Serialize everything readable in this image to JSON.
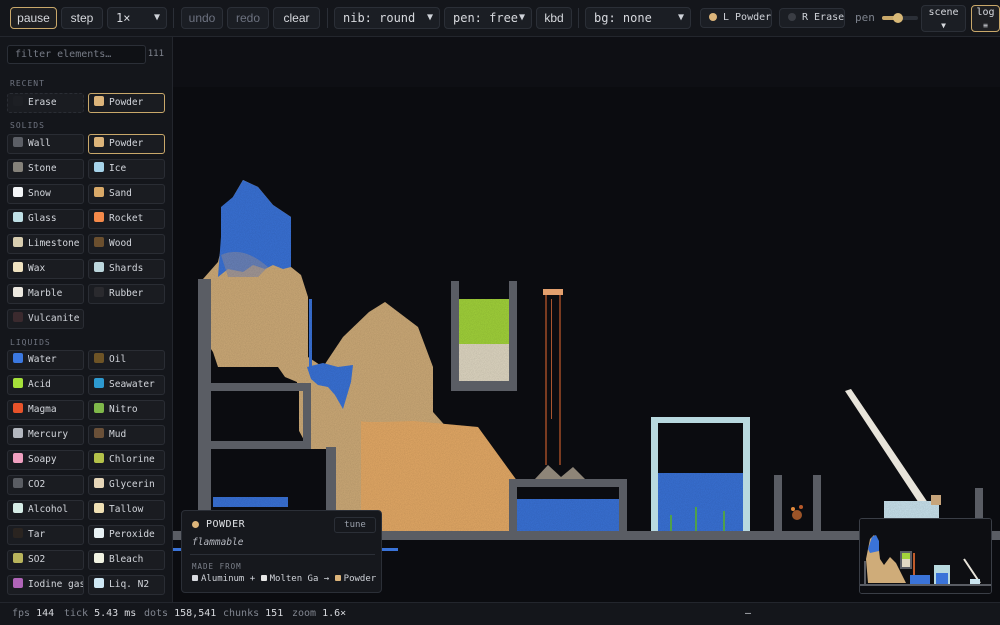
{
  "toolbar": {
    "pause": "pause",
    "step": "step",
    "speed": "1×",
    "undo": "undo",
    "redo": "redo",
    "clear": "clear",
    "nib": "nib: round",
    "pen": "pen: free",
    "kbd": "kbd",
    "bg": "bg: none",
    "left_brush": "L Powder",
    "right_brush": "R Erase",
    "pen_label": "pen",
    "pen_level": 0.45,
    "scene": "scene",
    "log": "log"
  },
  "sidebar": {
    "filter_placeholder": "filter elements…",
    "count": "111",
    "recent_label": "RECENT",
    "recent": [
      {
        "label": "Erase",
        "color": "#1d1f24"
      },
      {
        "label": "Powder",
        "color": "#dcb47a"
      }
    ],
    "solids_label": "SOLIDS",
    "solids": [
      {
        "label": "Wall",
        "color": "#5c5f66"
      },
      {
        "label": "Powder",
        "color": "#dcb47a"
      },
      {
        "label": "Stone",
        "color": "#85827a"
      },
      {
        "label": "Ice",
        "color": "#a7d4ea"
      },
      {
        "label": "Snow",
        "color": "#f4f6f8"
      },
      {
        "label": "Sand",
        "color": "#d9a968"
      },
      {
        "label": "Glass",
        "color": "#bfe0e6"
      },
      {
        "label": "Rocket",
        "color": "#f58a4a"
      },
      {
        "label": "Limestone",
        "color": "#d8cdb0"
      },
      {
        "label": "Wood",
        "color": "#6b4f2e"
      },
      {
        "label": "Wax",
        "color": "#efe2c0"
      },
      {
        "label": "Shards",
        "color": "#bcd6dc"
      },
      {
        "label": "Marble",
        "color": "#ece8e0"
      },
      {
        "label": "Rubber",
        "color": "#2a2a2e"
      },
      {
        "label": "Vulcanite",
        "color": "#3b2a2e"
      }
    ],
    "liquids_label": "LIQUIDS",
    "liquids": [
      {
        "label": "Water",
        "color": "#3b78e0"
      },
      {
        "label": "Oil",
        "color": "#6e5426"
      },
      {
        "label": "Acid",
        "color": "#a5e03a"
      },
      {
        "label": "Seawater",
        "color": "#2d9ad0"
      },
      {
        "label": "Magma",
        "color": "#e8532a"
      },
      {
        "label": "Nitro",
        "color": "#7fb84a"
      },
      {
        "label": "Mercury",
        "color": "#b3b7bf"
      },
      {
        "label": "Mud",
        "color": "#6a5038"
      },
      {
        "label": "Soapy",
        "color": "#f0a0c0"
      },
      {
        "label": "Chlorine",
        "color": "#b4c24a"
      },
      {
        "label": "CO2",
        "color": "#5a5d63"
      },
      {
        "label": "Glycerin",
        "color": "#e6d6b8"
      },
      {
        "label": "Alcohol",
        "color": "#d6ece6"
      },
      {
        "label": "Tallow",
        "color": "#efe0b4"
      },
      {
        "label": "Tar",
        "color": "#2a2420"
      },
      {
        "label": "Peroxide",
        "color": "#e8f1f4"
      },
      {
        "label": "SO2",
        "color": "#b8b45c"
      },
      {
        "label": "Bleach",
        "color": "#f0f2e2"
      },
      {
        "label": "Iodine gas",
        "color": "#b064b8"
      },
      {
        "label": "Liq. N2",
        "color": "#cfe8f4"
      }
    ]
  },
  "tooltip": {
    "title": "POWDER",
    "tune": "tune",
    "subtitle": "flammable",
    "made_from_label": "MADE FROM",
    "a": "Aluminum",
    "plus": "+",
    "b": "Molten Ga",
    "arrow": "→",
    "result": "Powder",
    "a_color": "#d8dadf",
    "b_color": "#e6e6e6",
    "result_color": "#dcb47a"
  },
  "status": {
    "fps_label": "fps",
    "fps": "144",
    "tick_label": "tick",
    "tick": "5.43 ms",
    "dots_label": "dots",
    "dots": "158,541",
    "chunks_label": "chunks",
    "chunks": "151",
    "zoom_label": "zoom",
    "zoom": "1.6×",
    "dash": "–"
  }
}
